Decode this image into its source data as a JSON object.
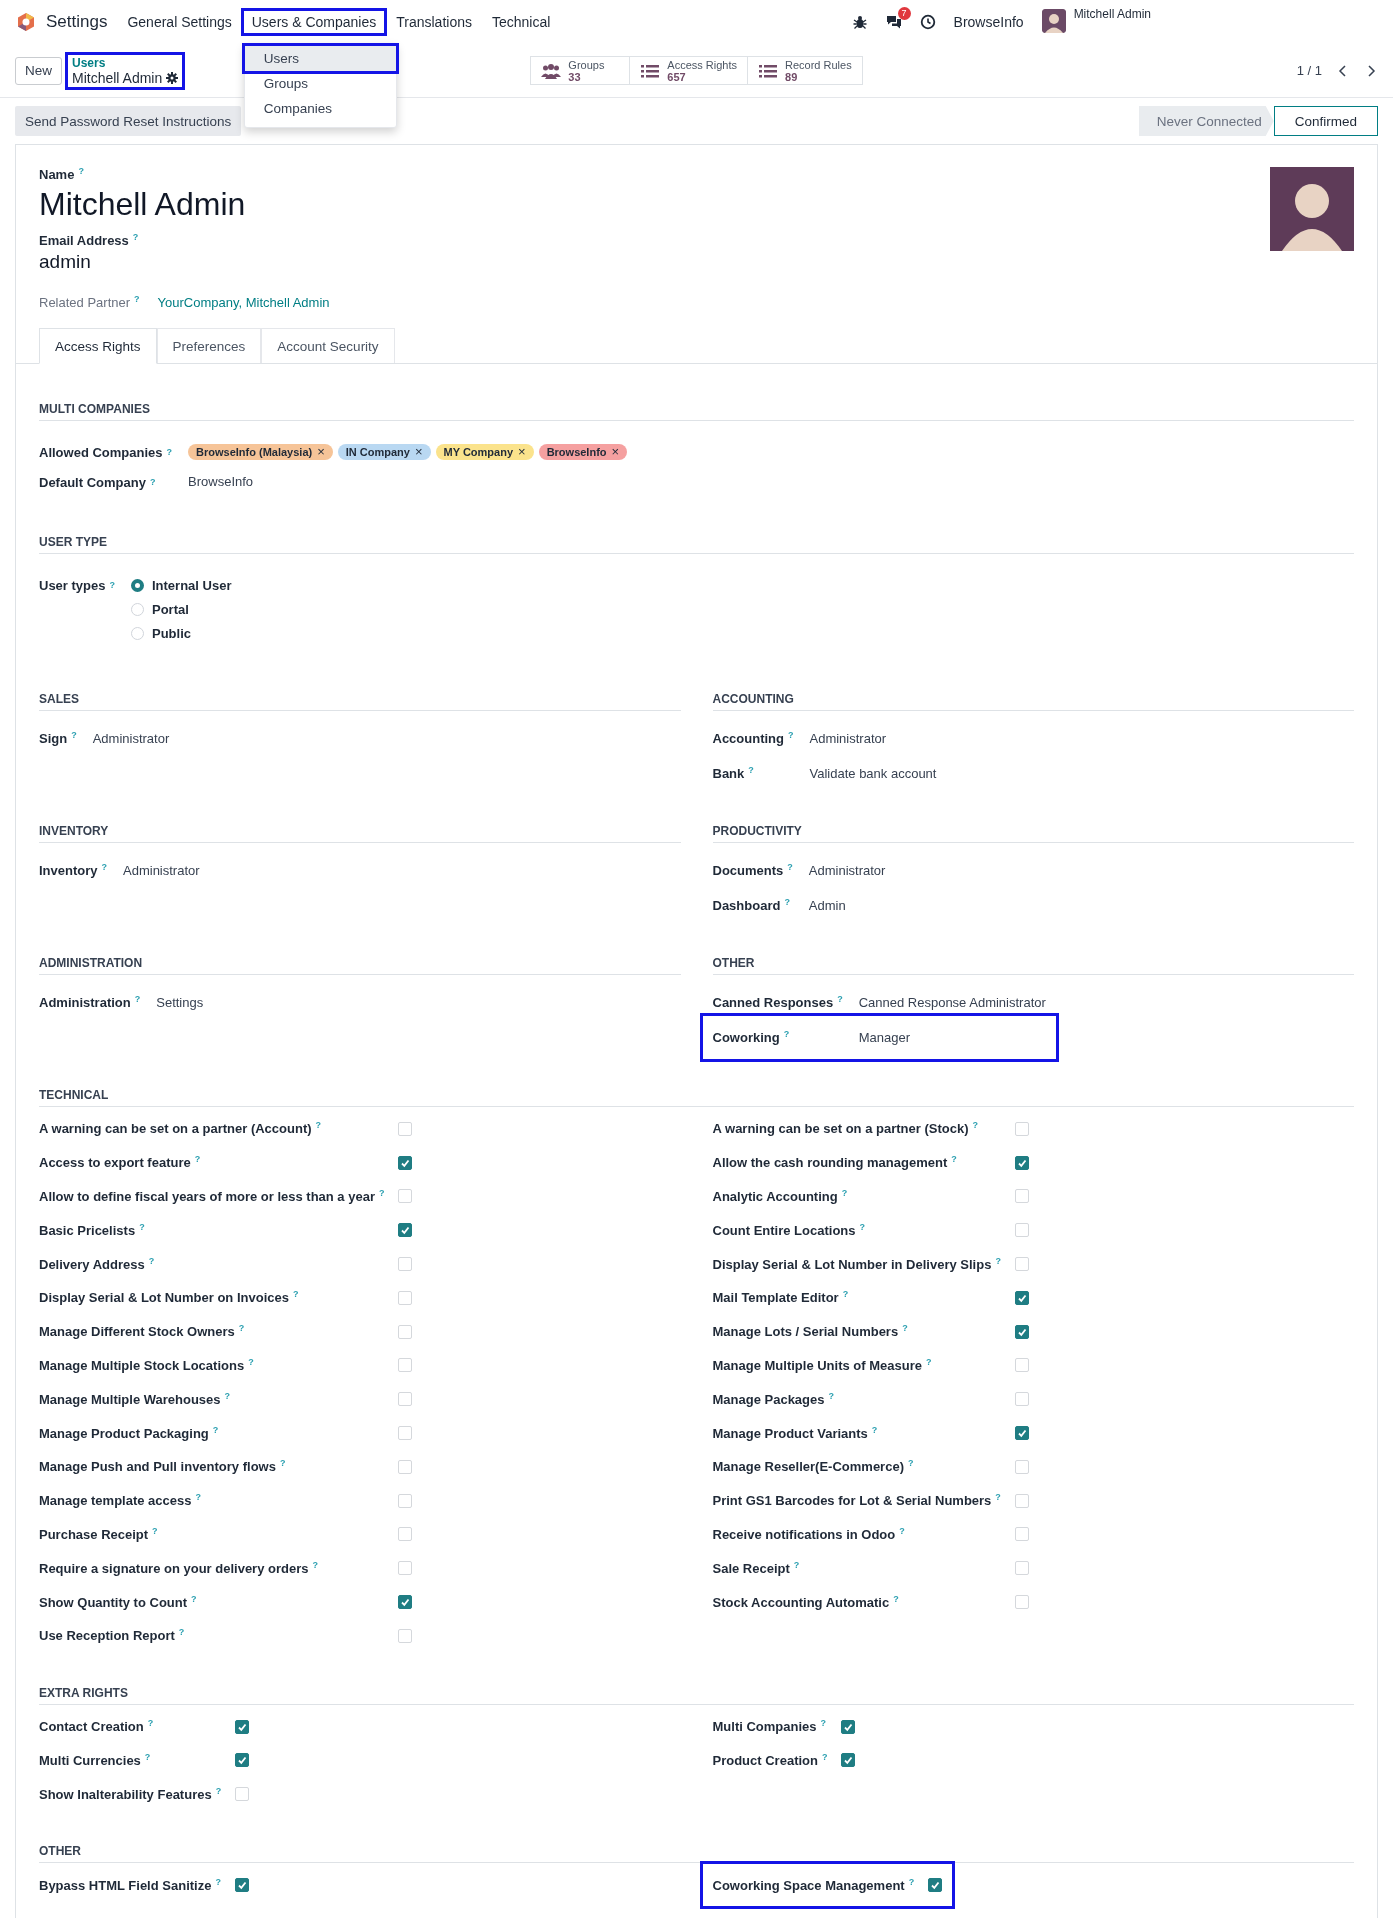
{
  "navbar": {
    "app": "Settings",
    "menus": [
      {
        "label": "General Settings",
        "highlighted": false
      },
      {
        "label": "Users & Companies",
        "highlighted": true
      },
      {
        "label": "Translations",
        "highlighted": false
      },
      {
        "label": "Technical",
        "highlighted": false
      }
    ],
    "notifications": "7",
    "company": "BrowseInfo",
    "user": "Mitchell Admin"
  },
  "dropdown": {
    "items": [
      {
        "label": "Users",
        "selected": true,
        "highlighted": true
      },
      {
        "label": "Groups",
        "selected": false,
        "highlighted": false
      },
      {
        "label": "Companies",
        "selected": false,
        "highlighted": false
      }
    ]
  },
  "control_panel": {
    "new_button": "New",
    "breadcrumb": {
      "parent": "Users",
      "current": "Mitchell Admin",
      "highlighted": true
    },
    "stats": [
      {
        "kind": "groups",
        "label": "Groups",
        "value": "33"
      },
      {
        "kind": "list",
        "label": "Access Rights",
        "value": "657"
      },
      {
        "kind": "list",
        "label": "Record Rules",
        "value": "89"
      }
    ],
    "pager": "1 / 1"
  },
  "actions": {
    "button": "Send Password Reset Instructions",
    "statusbar": [
      {
        "label": "Never Connected",
        "selected": false
      },
      {
        "label": "Confirmed",
        "selected": true
      }
    ]
  },
  "form": {
    "name": {
      "label": "Name",
      "help": "?",
      "value": "Mitchell Admin"
    },
    "email": {
      "label": "Email Address",
      "help": "?",
      "value": "admin"
    },
    "partner": {
      "label": "Related Partner",
      "help": "?",
      "value": "YourCompany, Mitchell Admin"
    }
  },
  "tabs": [
    {
      "label": "Access Rights",
      "selected": true
    },
    {
      "label": "Preferences",
      "selected": false
    },
    {
      "label": "Account Security",
      "selected": false
    }
  ],
  "sections": [
    {
      "kind": "fields",
      "title": "MULTI COMPANIES",
      "fields": [
        {
          "kind": "tags",
          "label": "Allowed Companies",
          "help": "?",
          "tags": [
            {
              "label": "BrowseInfo (Malaysia)",
              "remove": "×",
              "color": "#f6c498"
            },
            {
              "label": "IN Company",
              "remove": "×",
              "color": "#b9d8f2"
            },
            {
              "label": "MY Company",
              "remove": "×",
              "color": "#fbe38c"
            },
            {
              "label": "BrowseInfo",
              "remove": "×",
              "color": "#f5a0a0"
            }
          ]
        },
        {
          "kind": "text",
          "label": "Default Company",
          "help": "?",
          "value": "BrowseInfo"
        }
      ]
    },
    {
      "kind": "fields",
      "title": "USER TYPE",
      "fields": [
        {
          "kind": "radio",
          "label": "User types",
          "help": "?",
          "options": [
            {
              "label": "Internal User",
              "selected": true
            },
            {
              "label": "Portal",
              "selected": false
            },
            {
              "label": "Public",
              "selected": false
            }
          ]
        }
      ]
    },
    {
      "kind": "pair",
      "groups": [
        {
          "title": "SALES",
          "fields": [
            {
              "label": "Sign",
              "help": "?",
              "value": "Administrator"
            }
          ]
        },
        {
          "title": "ACCOUNTING",
          "fields": [
            {
              "label": "Accounting",
              "help": "?",
              "value": "Administrator"
            },
            {
              "label": "Bank",
              "help": "?",
              "value": "Validate bank account"
            }
          ]
        }
      ]
    },
    {
      "kind": "pair",
      "groups": [
        {
          "title": "INVENTORY",
          "fields": [
            {
              "label": "Inventory",
              "help": "?",
              "value": "Administrator"
            }
          ]
        },
        {
          "title": "PRODUCTIVITY",
          "fields": [
            {
              "label": "Documents",
              "help": "?",
              "value": "Administrator"
            },
            {
              "label": "Dashboard",
              "help": "?",
              "value": "Admin"
            }
          ]
        }
      ]
    },
    {
      "kind": "pair",
      "groups": [
        {
          "title": "ADMINISTRATION",
          "fields": [
            {
              "label": "Administration",
              "help": "?",
              "value": "Settings"
            }
          ]
        },
        {
          "title": "OTHER",
          "fields": [
            {
              "label": "Canned Responses",
              "help": "?",
              "value": "Canned Response Administrator",
              "highlighted": false
            },
            {
              "label": "Coworking",
              "help": "?",
              "value": "Manager",
              "highlighted": true
            }
          ]
        }
      ]
    },
    {
      "kind": "checks",
      "title": "TECHNICAL",
      "columns": [
        [
          {
            "label": "A warning can be set on a partner (Account)",
            "help": "?",
            "checked": false
          },
          {
            "label": "Access to export feature",
            "help": "?",
            "checked": true
          },
          {
            "label": "Allow to define fiscal years of more or less than a year",
            "help": "?",
            "checked": false
          },
          {
            "label": "Basic Pricelists",
            "help": "?",
            "checked": true
          },
          {
            "label": "Delivery Address",
            "help": "?",
            "checked": false
          },
          {
            "label": "Display Serial & Lot Number on Invoices",
            "help": "?",
            "checked": false
          },
          {
            "label": "Manage Different Stock Owners",
            "help": "?",
            "checked": false
          },
          {
            "label": "Manage Multiple Stock Locations",
            "help": "?",
            "checked": false
          },
          {
            "label": "Manage Multiple Warehouses",
            "help": "?",
            "checked": false
          },
          {
            "label": "Manage Product Packaging",
            "help": "?",
            "checked": false
          },
          {
            "label": "Manage Push and Pull inventory flows",
            "help": "?",
            "checked": false
          },
          {
            "label": "Manage template access",
            "help": "?",
            "checked": false
          },
          {
            "label": "Purchase Receipt",
            "help": "?",
            "checked": false
          },
          {
            "label": "Require a signature on your delivery orders",
            "help": "?",
            "checked": false
          },
          {
            "label": "Show Quantity to Count",
            "help": "?",
            "checked": true
          },
          {
            "label": "Use Reception Report",
            "help": "?",
            "checked": false
          }
        ],
        [
          {
            "label": "A warning can be set on a partner (Stock)",
            "help": "?",
            "checked": false
          },
          {
            "label": "Allow the cash rounding management",
            "help": "?",
            "checked": true
          },
          {
            "label": "Analytic Accounting",
            "help": "?",
            "checked": false
          },
          {
            "label": "Count Entire Locations",
            "help": "?",
            "checked": false
          },
          {
            "label": "Display Serial & Lot Number in Delivery Slips",
            "help": "?",
            "checked": false
          },
          {
            "label": "Mail Template Editor",
            "help": "?",
            "checked": true
          },
          {
            "label": "Manage Lots / Serial Numbers",
            "help": "?",
            "checked": true
          },
          {
            "label": "Manage Multiple Units of Measure",
            "help": "?",
            "checked": false
          },
          {
            "label": "Manage Packages",
            "help": "?",
            "checked": false
          },
          {
            "label": "Manage Product Variants",
            "help": "?",
            "checked": true
          },
          {
            "label": "Manage Reseller(E-Commerce)",
            "help": "?",
            "checked": false
          },
          {
            "label": "Print GS1 Barcodes for Lot & Serial Numbers",
            "help": "?",
            "checked": false
          },
          {
            "label": "Receive notifications in Odoo",
            "help": "?",
            "checked": false
          },
          {
            "label": "Sale Receipt",
            "help": "?",
            "checked": false
          },
          {
            "label": "Stock Accounting Automatic",
            "help": "?",
            "checked": false
          }
        ]
      ]
    },
    {
      "kind": "checks",
      "title": "EXTRA RIGHTS",
      "columns": [
        [
          {
            "label": "Contact Creation",
            "help": "?",
            "checked": true
          },
          {
            "label": "Multi Currencies",
            "help": "?",
            "checked": true
          },
          {
            "label": "Show Inalterability Features",
            "help": "?",
            "checked": false
          }
        ],
        [
          {
            "label": "Multi Companies",
            "help": "?",
            "checked": true
          },
          {
            "label": "Product Creation",
            "help": "?",
            "checked": true
          }
        ]
      ]
    },
    {
      "kind": "checks",
      "title": "OTHER",
      "columns": [
        [
          {
            "label": "Bypass HTML Field Sanitize",
            "help": "?",
            "checked": true,
            "highlighted": false
          }
        ],
        [
          {
            "label": "Coworking Space Management",
            "help": "?",
            "checked": true,
            "highlighted": true
          }
        ]
      ]
    }
  ]
}
